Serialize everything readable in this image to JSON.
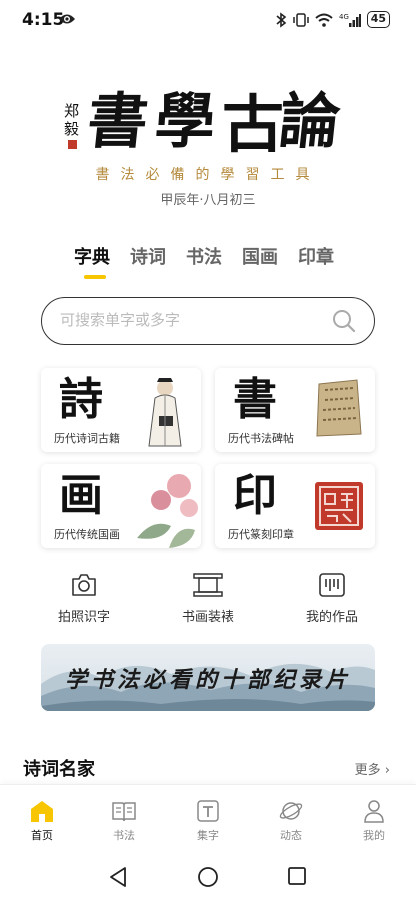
{
  "status_bar": {
    "time": "4:15",
    "signal_label": "4G",
    "battery": "45"
  },
  "hero": {
    "title": "書學古論",
    "tagline": "書法必備的學習工具",
    "lunar_date": "甲辰年·八月初三"
  },
  "tabs": [
    {
      "label": "字典",
      "active": true
    },
    {
      "label": "诗词",
      "active": false
    },
    {
      "label": "书法",
      "active": false
    },
    {
      "label": "国画",
      "active": false
    },
    {
      "label": "印章",
      "active": false
    }
  ],
  "search": {
    "placeholder": "可搜索单字或多字"
  },
  "cards": [
    {
      "glyph": "詩",
      "label": "历代诗词古籍"
    },
    {
      "glyph": "書",
      "label": "历代书法碑帖"
    },
    {
      "glyph": "画",
      "label": "历代传统国画"
    },
    {
      "glyph": "印",
      "label": "历代篆刻印章"
    }
  ],
  "quick_actions": [
    {
      "label": "拍照识字",
      "icon": "camera-icon"
    },
    {
      "label": "书画装裱",
      "icon": "frame-icon"
    },
    {
      "label": "我的作品",
      "icon": "works-icon"
    }
  ],
  "banner": {
    "text": "学书法必看的十部纪录片"
  },
  "section": {
    "title": "诗词名家",
    "more": "更多 ›"
  },
  "bottom_nav": [
    {
      "label": "首页",
      "icon": "home-icon",
      "active": true
    },
    {
      "label": "书法",
      "icon": "book-icon",
      "active": false
    },
    {
      "label": "集字",
      "icon": "text-icon",
      "active": false
    },
    {
      "label": "动态",
      "icon": "planet-icon",
      "active": false
    },
    {
      "label": "我的",
      "icon": "user-icon",
      "active": false
    }
  ],
  "colors": {
    "accent": "#f7c600",
    "tagline": "#b58a3c",
    "seal_red": "#c0392b"
  }
}
